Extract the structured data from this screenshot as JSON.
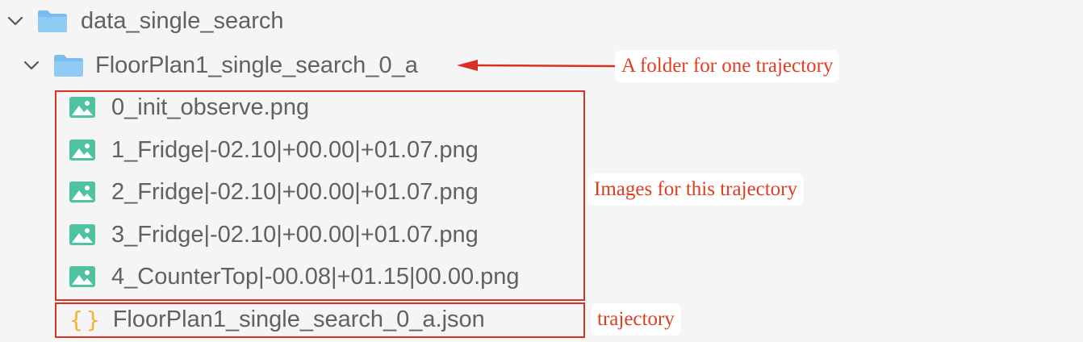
{
  "tree": {
    "root": {
      "label": "data_single_search",
      "expanded": true,
      "icon": "folder-icon"
    },
    "folder": {
      "label": "FloorPlan1_single_search_0_a",
      "expanded": true,
      "icon": "folder-icon"
    },
    "files": [
      {
        "label": "0_init_observe.png",
        "icon": "image-file-icon"
      },
      {
        "label": "1_Fridge|-02.10|+00.00|+01.07.png",
        "icon": "image-file-icon"
      },
      {
        "label": "2_Fridge|-02.10|+00.00|+01.07.png",
        "icon": "image-file-icon"
      },
      {
        "label": "3_Fridge|-02.10|+00.00|+01.07.png",
        "icon": "image-file-icon"
      },
      {
        "label": "4_CounterTop|-00.08|+01.15|00.00.png",
        "icon": "image-file-icon"
      }
    ],
    "json_file": {
      "label": "FloorPlan1_single_search_0_a.json",
      "icon_glyph": "{}",
      "icon": "json-file-icon"
    }
  },
  "annotations": {
    "folder_note": "A folder for one trajectory",
    "images_note": "Images for this trajectory",
    "json_note": "trajectory"
  },
  "colors": {
    "annotation_red": "#e03c21",
    "folder_blue": "#7bbcef",
    "image_green": "#4fc3a1",
    "json_yellow": "#f2b531",
    "text_gray": "#616161"
  }
}
